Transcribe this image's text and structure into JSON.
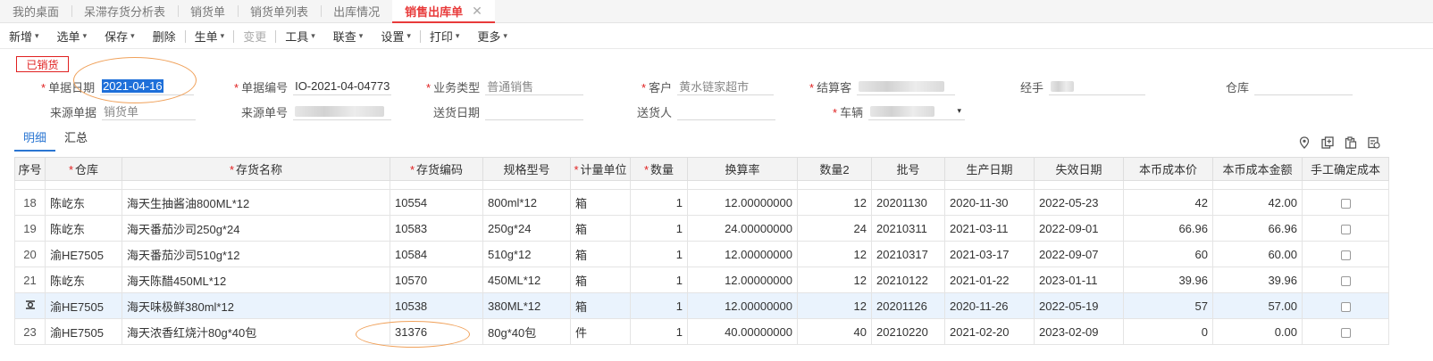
{
  "tabs": [
    {
      "label": "我的桌面",
      "active": false
    },
    {
      "label": "呆滞存货分析表",
      "active": false
    },
    {
      "label": "销货单",
      "active": false
    },
    {
      "label": "销货单列表",
      "active": false
    },
    {
      "label": "出库情况",
      "active": false
    },
    {
      "label": "销售出库单",
      "active": true,
      "close": "✕"
    }
  ],
  "toolbar": {
    "new": "新增",
    "select": "选单",
    "save": "保存",
    "delete": "删除",
    "generate": "生单",
    "change": "变更",
    "tools": "工具",
    "query": "联查",
    "settings": "设置",
    "print": "打印",
    "more": "更多",
    "caret": "▾"
  },
  "status": "已销货",
  "form": {
    "date_label": "单据日期",
    "date_value": "2021-04-16",
    "code_label": "单据编号",
    "code_value": "IO-2021-04-04773",
    "biztype_label": "业务类型",
    "biztype_placeholder": "普通销售",
    "customer_label": "客户",
    "customer_value": "黄水链家超市",
    "settle_label": "结算客",
    "handler_label": "经手",
    "warehouse_label": "仓库",
    "source_label": "来源单据",
    "source_value": "销货单",
    "source_no_label": "来源单号",
    "ship_date_label": "送货日期",
    "shipper_label": "送货人",
    "vehicle_label": "车辆",
    "required_mark": "*"
  },
  "subtabs": {
    "detail": "明细",
    "summary": "汇总"
  },
  "table": {
    "headers": [
      {
        "label": "序号",
        "req": false
      },
      {
        "label": "仓库",
        "req": true
      },
      {
        "label": "存货名称",
        "req": true
      },
      {
        "label": "存货编码",
        "req": true
      },
      {
        "label": "规格型号",
        "req": false
      },
      {
        "label": "计量单位",
        "req": true
      },
      {
        "label": "数量",
        "req": true
      },
      {
        "label": "换算率",
        "req": false
      },
      {
        "label": "数量2",
        "req": false
      },
      {
        "label": "批号",
        "req": false
      },
      {
        "label": "生产日期",
        "req": false
      },
      {
        "label": "失效日期",
        "req": false
      },
      {
        "label": "本币成本价",
        "req": false
      },
      {
        "label": "本币成本金额",
        "req": false
      },
      {
        "label": "手工确定成本",
        "req": false
      }
    ],
    "rows": [
      {
        "idx": "18",
        "wh": "陈屹东",
        "name": "海天生抽酱油800ML*12",
        "code": "10554",
        "spec": "800ml*12",
        "unit": "箱",
        "qty": "1",
        "rate": "12.00000000",
        "qty2": "12",
        "batch": "20201130",
        "prod": "2020-11-30",
        "exp": "2022-05-23",
        "price": "42",
        "amount": "42.00"
      },
      {
        "idx": "19",
        "wh": "陈屹东",
        "name": "海天番茄沙司250g*24",
        "code": "10583",
        "spec": "250g*24",
        "unit": "箱",
        "qty": "1",
        "rate": "24.00000000",
        "qty2": "24",
        "batch": "20210311",
        "prod": "2021-03-11",
        "exp": "2022-09-01",
        "price": "66.96",
        "amount": "66.96"
      },
      {
        "idx": "20",
        "wh": "渝HE7505",
        "name": "海天番茄沙司510g*12",
        "code": "10584",
        "spec": "510g*12",
        "unit": "箱",
        "qty": "1",
        "rate": "12.00000000",
        "qty2": "12",
        "batch": "20210317",
        "prod": "2021-03-17",
        "exp": "2022-09-07",
        "price": "60",
        "amount": "60.00"
      },
      {
        "idx": "21",
        "wh": "陈屹东",
        "name": "海天陈醋450ML*12",
        "code": "10570",
        "spec": "450ML*12",
        "unit": "箱",
        "qty": "1",
        "rate": "12.00000000",
        "qty2": "12",
        "batch": "20210122",
        "prod": "2021-01-22",
        "exp": "2023-01-11",
        "price": "39.96",
        "amount": "39.96"
      },
      {
        "idx": "",
        "wh": "渝HE7505",
        "name": "海天味极鲜380ml*12",
        "code": "10538",
        "spec": "380ML*12",
        "unit": "箱",
        "qty": "1",
        "rate": "12.00000000",
        "qty2": "12",
        "batch": "20201126",
        "prod": "2020-11-26",
        "exp": "2022-05-19",
        "price": "57",
        "amount": "57.00"
      },
      {
        "idx": "23",
        "wh": "渝HE7505",
        "name": "海天浓香红烧汁80g*40包",
        "code": "31376",
        "spec": "80g*40包",
        "unit": "件",
        "qty": "1",
        "rate": "40.00000000",
        "qty2": "40",
        "batch": "20210220",
        "prod": "2021-02-20",
        "exp": "2023-02-09",
        "price": "0",
        "amount": "0.00"
      }
    ]
  }
}
